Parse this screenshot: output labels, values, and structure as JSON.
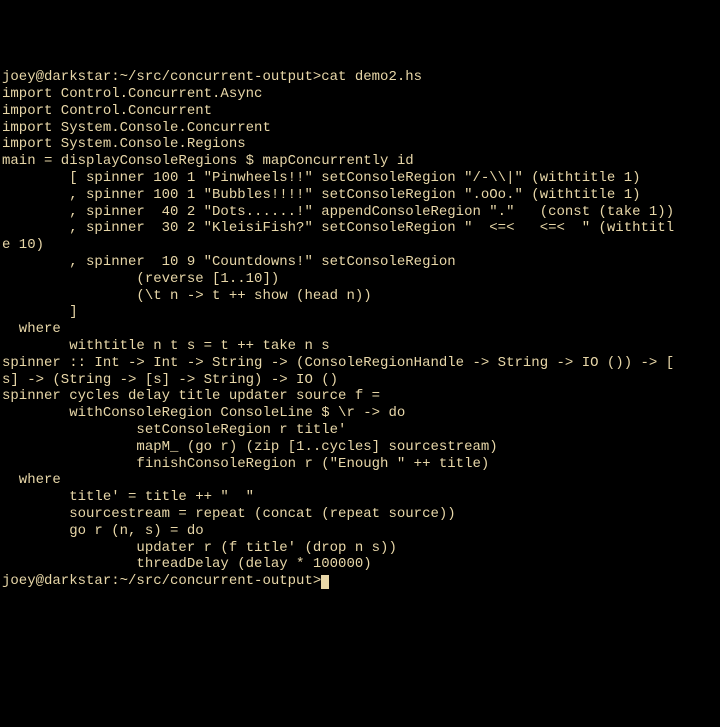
{
  "prompt1_full": "joey@darkstar:~/src/concurrent-output>cat demo2.hs",
  "lines": [
    "import Control.Concurrent.Async",
    "import Control.Concurrent",
    "import System.Console.Concurrent",
    "import System.Console.Regions",
    "",
    "main = displayConsoleRegions $ mapConcurrently id",
    "        [ spinner 100 1 \"Pinwheels!!\" setConsoleRegion \"/-\\\\|\" (withtitle 1)",
    "        , spinner 100 1 \"Bubbles!!!!\" setConsoleRegion \".oOo.\" (withtitle 1)",
    "        , spinner  40 2 \"Dots......!\" appendConsoleRegion \".\"   (const (take 1))",
    "        , spinner  30 2 \"KleisiFish?\" setConsoleRegion \"  <=<   <=<  \" (withtitl",
    "e 10)",
    "        , spinner  10 9 \"Countdowns!\" setConsoleRegion",
    "                (reverse [1..10])",
    "                (\\t n -> t ++ show (head n))",
    "        ]",
    "  where",
    "        withtitle n t s = t ++ take n s",
    "",
    "spinner :: Int -> Int -> String -> (ConsoleRegionHandle -> String -> IO ()) -> [",
    "s] -> (String -> [s] -> String) -> IO ()",
    "spinner cycles delay title updater source f =",
    "        withConsoleRegion ConsoleLine $ \\r -> do",
    "                setConsoleRegion r title'",
    "                mapM_ (go r) (zip [1..cycles] sourcestream)",
    "                finishConsoleRegion r (\"Enough \" ++ title)",
    "  where",
    "        title' = title ++ \"  \"",
    "        sourcestream = repeat (concat (repeat source))",
    "        go r (n, s) = do",
    "                updater r (f title' (drop n s))",
    "                threadDelay (delay * 100000)"
  ],
  "prompt2": "joey@darkstar:~/src/concurrent-output>"
}
